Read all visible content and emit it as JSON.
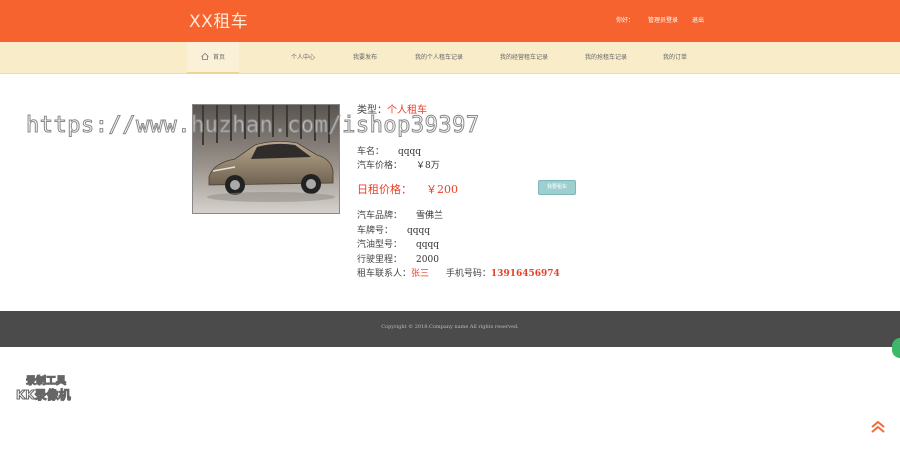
{
  "header": {
    "logo": "XX租车",
    "links": [
      "你好：",
      "管理员登录",
      "退出"
    ]
  },
  "nav": {
    "items": [
      "首页",
      "个人中心",
      "我要发布",
      "我的个人租车记录",
      "我的经营租车记录",
      "我的抢租车记录",
      "我的订单"
    ]
  },
  "car": {
    "type_label": "类型：",
    "type_value": "个人租车",
    "name_label": "车名：",
    "name_value": "qqqq",
    "price_label": "汽车价格：",
    "price_value": "￥8万",
    "daily_label": "日租价格：",
    "daily_value": "￥200",
    "rent_button": "我要租车",
    "brand_label": "汽车品牌：",
    "brand_value": "雪佛兰",
    "plate_label": "车牌号：",
    "plate_value": "qqqq",
    "fuel_label": "汽油型号：",
    "fuel_value": "qqqq",
    "mileage_label": "行驶里程：",
    "mileage_value": "2000",
    "contact_label": "租车联系人：",
    "contact_value": "张三",
    "phone_label": "手机号码：",
    "phone_value": "13916456974"
  },
  "watermark": "https://www.huzhan.com/ishop39397",
  "footer": {
    "copyright": "Copyright © 2018.Company name All rights reserved."
  },
  "recorder": {
    "line1": "录制工具",
    "line2": "KK录像机"
  },
  "colors": {
    "header": "#f6632f",
    "nav": "#f8ecc9",
    "accent_red": "#e8412b",
    "footer": "#4b4b4b",
    "button": "#9ecfd0"
  }
}
